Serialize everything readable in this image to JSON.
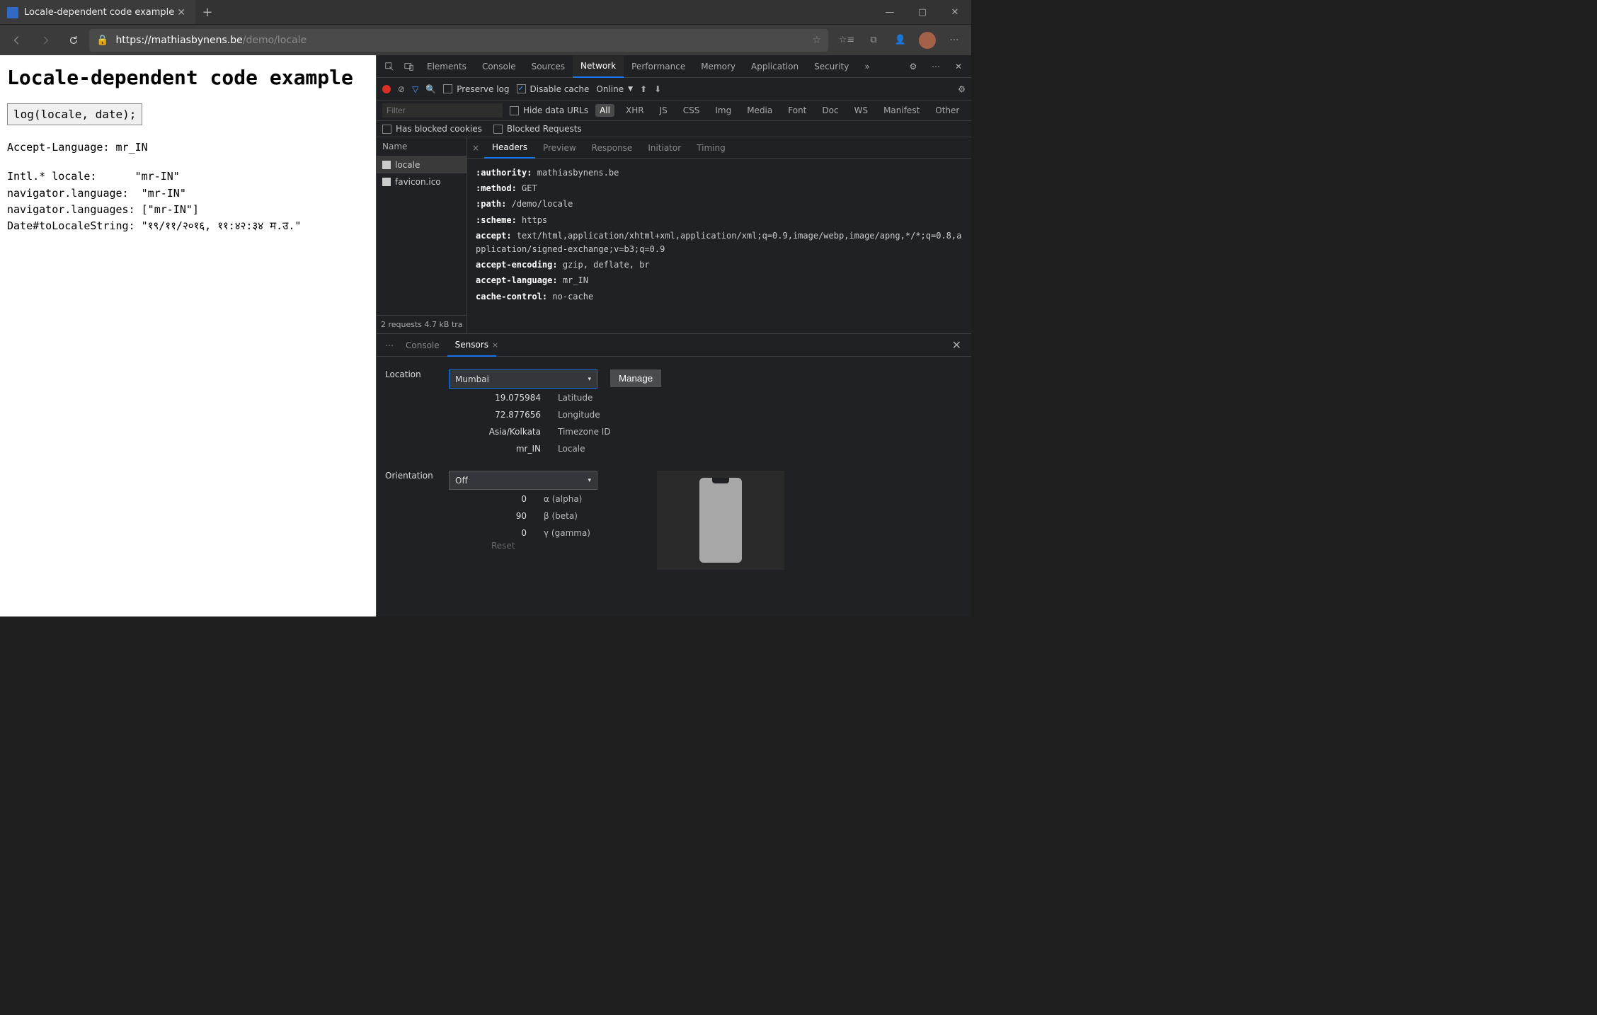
{
  "browser": {
    "tab_title": "Locale-dependent code example",
    "url_host": "https://mathiasbynens.be",
    "url_path": "/demo/locale"
  },
  "page": {
    "heading": "Locale-dependent code example",
    "button": "log(locale, date);",
    "line_accept": "Accept-Language: mr_IN",
    "body": "Intl.* locale:      \"mr-IN\"\nnavigator.language:  \"mr-IN\"\nnavigator.languages: [\"mr-IN\"]\nDate#toLocaleString: \"१९/११/२०१६, ११:४२:३४ म.उ.\""
  },
  "devtools": {
    "tabs": [
      "Elements",
      "Console",
      "Sources",
      "Network",
      "Performance",
      "Memory",
      "Application",
      "Security"
    ],
    "active_tab": "Network",
    "preserve_log": "Preserve log",
    "disable_cache": "Disable cache",
    "online": "Online",
    "filter_placeholder": "Filter",
    "hide_data_urls": "Hide data URLs",
    "pills": [
      "All",
      "XHR",
      "JS",
      "CSS",
      "Img",
      "Media",
      "Font",
      "Doc",
      "WS",
      "Manifest",
      "Other"
    ],
    "blocked_cookies": "Has blocked cookies",
    "blocked_requests": "Blocked Requests",
    "name_header": "Name",
    "requests": [
      "locale",
      "favicon.ico"
    ],
    "status_bar": "2 requests  4.7 kB tra",
    "detail_tabs": [
      "Headers",
      "Preview",
      "Response",
      "Initiator",
      "Timing"
    ],
    "headers": {
      "authority": "mathiasbynens.be",
      "method": "GET",
      "path": "/demo/locale",
      "scheme": "https",
      "accept": "text/html,application/xhtml+xml,application/xml;q=0.9,image/webp,image/apng,*/*;q=0.8,application/signed-exchange;v=b3;q=0.9",
      "accept_encoding": "gzip, deflate, br",
      "accept_language": "mr_IN",
      "cache_control": "no-cache"
    }
  },
  "drawer": {
    "console": "Console",
    "sensors": "Sensors",
    "location_label": "Location",
    "location_value": "Mumbai",
    "manage": "Manage",
    "latitude_v": "19.075984",
    "latitude_l": "Latitude",
    "longitude_v": "72.877656",
    "longitude_l": "Longitude",
    "timezone_v": "Asia/Kolkata",
    "timezone_l": "Timezone ID",
    "locale_v": "mr_IN",
    "locale_l": "Locale",
    "orientation_label": "Orientation",
    "orientation_value": "Off",
    "alpha_v": "0",
    "alpha_l": "α (alpha)",
    "beta_v": "90",
    "beta_l": "β (beta)",
    "gamma_v": "0",
    "gamma_l": "γ (gamma)",
    "reset": "Reset"
  }
}
